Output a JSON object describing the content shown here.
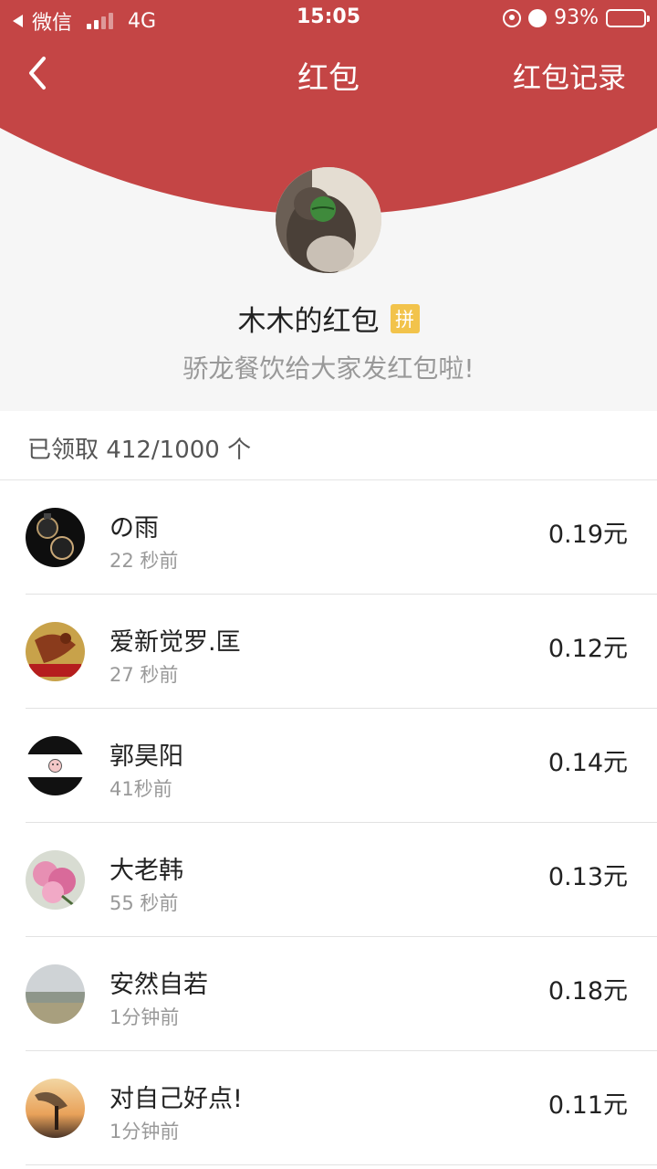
{
  "status_bar": {
    "carrier": "微信",
    "network": "4G",
    "time": "15:05",
    "battery": "93%",
    "battery_level": 0.93
  },
  "nav": {
    "title": "红包",
    "record_label": "红包记录"
  },
  "sender": {
    "name": "木木的红包",
    "badge": "拼",
    "blessing": "骄龙餐饮给大家发红包啦!"
  },
  "summary": {
    "received_text": "已领取 412/1000 个"
  },
  "colors": {
    "header_red": "#c44545",
    "badge_yellow": "#f2c34b",
    "battery_yellow": "#f5d547"
  },
  "recipients": [
    {
      "name": "の雨",
      "time": "22 秒前",
      "amount": "0.19元"
    },
    {
      "name": "爱新觉罗.匡",
      "time": "27 秒前",
      "amount": "0.12元"
    },
    {
      "name": "郭昊阳",
      "time": "41秒前",
      "amount": "0.14元"
    },
    {
      "name": "大老韩",
      "time": "55 秒前",
      "amount": "0.13元"
    },
    {
      "name": "安然自若",
      "time": "1分钟前",
      "amount": "0.18元"
    },
    {
      "name": "对自己好点!",
      "time": "1分钟前",
      "amount": "0.11元"
    }
  ]
}
